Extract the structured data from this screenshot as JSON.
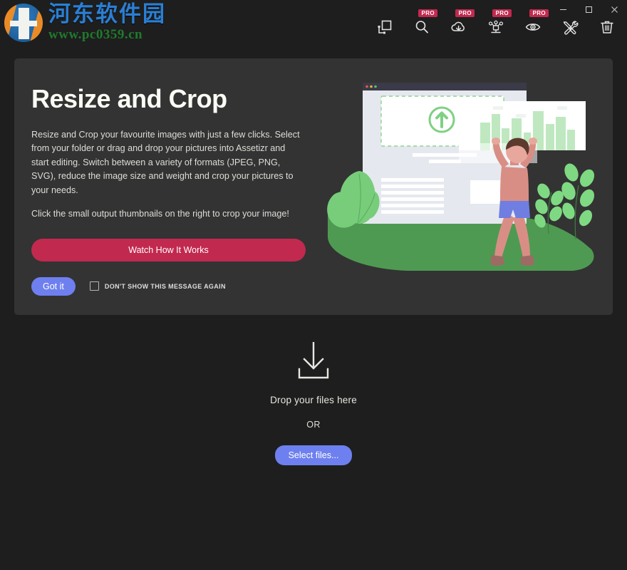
{
  "window": {
    "background": "#1e1e1e",
    "controls": [
      {
        "name": "minimize",
        "glyph": "minimize-icon"
      },
      {
        "name": "maximize",
        "glyph": "maximize-icon"
      },
      {
        "name": "close",
        "glyph": "close-icon"
      }
    ]
  },
  "watermark": {
    "chinese": "河东软件园",
    "url": "www.pc0359.cn"
  },
  "toolbar": {
    "pro_label": "PRO",
    "items": [
      {
        "icon": "resize-crop-icon",
        "pro": false,
        "name": "resize-crop-tool"
      },
      {
        "icon": "search-icon",
        "pro": true,
        "name": "search-tool"
      },
      {
        "icon": "cloud-download-icon",
        "pro": true,
        "name": "cloud-download-tool"
      },
      {
        "icon": "share-network-icon",
        "pro": true,
        "name": "share-network-tool"
      },
      {
        "icon": "eye-icon",
        "pro": true,
        "name": "preview-tool"
      },
      {
        "icon": "tools-icon",
        "pro": false,
        "name": "settings-tools"
      },
      {
        "icon": "trash-icon",
        "pro": false,
        "name": "delete-tool"
      }
    ]
  },
  "panel": {
    "title": "Resize and Crop",
    "paragraph1": "Resize and Crop your favourite images with just a few clicks. Select from your folder or drag and drop your pictures into Assetizr and start editing. Switch between a variety of formats (JPEG, PNG, SVG), reduce the image size and weight and crop your pictures to your needs.",
    "paragraph2": "Click the small output thumbnails on the right to crop your image!",
    "watch_button": "Watch How It Works",
    "gotit_button": "Got it",
    "dont_show_label": "DON'T SHOW THIS MESSAGE AGAIN",
    "dont_show_checked": false,
    "accent_red": "#c2294f",
    "accent_blue": "#6e80ef",
    "background": "#333333"
  },
  "dropzone": {
    "icon": "download-arrow-icon",
    "drop_text": "Drop your files here",
    "or_text": "OR",
    "select_button": "Select files..."
  }
}
